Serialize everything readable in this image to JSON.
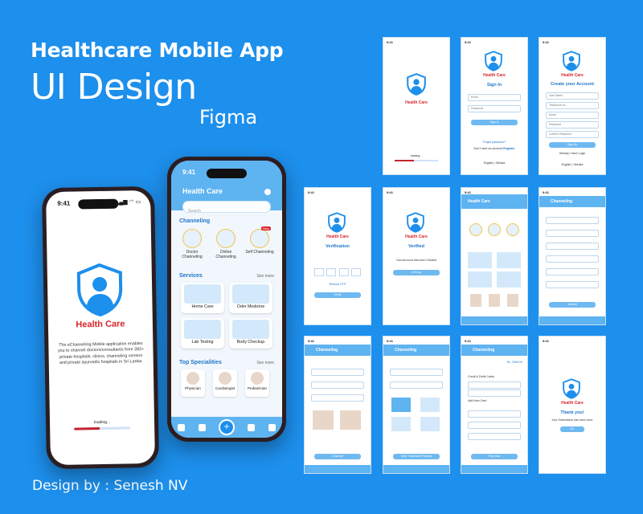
{
  "hero": {
    "line1": "Healthcare Mobile App",
    "line2": "UI Design",
    "line3": "Figma",
    "credit": "Design by : Senesh NV"
  },
  "colors": {
    "background": "#1d8fec",
    "brand_blue": "#5eb3f1",
    "brand_red": "#d9262c"
  },
  "phone1": {
    "time": "9:41",
    "brand": "Health Care",
    "description": "The eChanneling Mobile application enables you to channel doctors/consultants from 282+ private hospitals, clinics, channeling centers and private ayurvedic hospitals in Sri Lanka.",
    "loading": "loading...",
    "progress": 0.45
  },
  "phone2": {
    "time": "9:41",
    "title": "Health Care",
    "search_placeholder": "Search",
    "channeling_title": "Channeling",
    "channeling": [
      "Doctor Channeling",
      "Online Channeling",
      "Self Channeling"
    ],
    "new_badge": "New",
    "services_title": "Services",
    "see_more": "See more",
    "services": [
      "Home Care",
      "Oder Medicine",
      "Lab Testing",
      "Body Checkup"
    ],
    "specialities_title": "Top Specialities",
    "specialities": [
      "Physician",
      "Cardiologist",
      "Pediatrician"
    ]
  },
  "screens": {
    "splash": {
      "time": "9:41",
      "brand": "Health Care",
      "loading": "loading..."
    },
    "signin": {
      "time": "9:41",
      "brand": "Health Care",
      "title": "Sign In",
      "email": "Email",
      "password": "Password",
      "button": "Sign In",
      "forgot": "Forget password?",
      "no_account": "Don't have an account",
      "register": "Register",
      "lang": "English | Sinhala"
    },
    "create": {
      "time": "9:41",
      "brand": "Health Care",
      "title": "Create your Account",
      "fields": [
        "User Name",
        "Telephone no.",
        "Email",
        "Password",
        "Confirm Password"
      ],
      "button": "Sign Up",
      "have_account": "Already i have Login",
      "lang": "English | Sinhala"
    },
    "verify": {
      "time": "9:41",
      "brand": "Health Care",
      "title": "Verification",
      "button": "Verify",
      "resend": "Resend OTP"
    },
    "verified": {
      "time": "9:41",
      "brand": "Health Care",
      "title": "Verified",
      "msg": "Your Account has been Created",
      "button": "Let's go"
    },
    "home": {
      "time": "9:41",
      "title": "Health Care"
    },
    "channeling": {
      "time": "9:41",
      "title": "Channeling",
      "submit": "Submit"
    },
    "channeling2": {
      "time": "9:41",
      "title": "Channeling",
      "button": "Channel"
    },
    "channeling3": {
      "time": "9:41",
      "title": "Channeling",
      "button": "View Treatment Process"
    },
    "payment": {
      "time": "9:41",
      "title": "Channeling",
      "card_title": "Credit & Debit Cards",
      "add_card": "Add New Card",
      "button": "Pay Now",
      "price": "Rs. 2950.00"
    },
    "thanks": {
      "time": "9:41",
      "brand": "Health Care",
      "title": "Thank you!",
      "msg": "Your Submission has been sent.",
      "button": "OK"
    }
  }
}
